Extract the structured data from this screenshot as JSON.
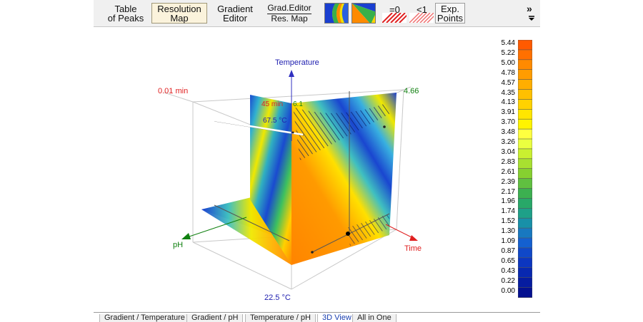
{
  "toolbar": {
    "table_of_peaks": [
      "Table",
      "of Peaks"
    ],
    "resolution_map": [
      "Resolution",
      "Map"
    ],
    "gradient_editor": [
      "Gradient",
      "Editor"
    ],
    "grad_editor_res_map": [
      "Grad.Editor",
      "Res. Map"
    ],
    "eq0_label": "=0",
    "lt1_label": "<1",
    "exp_points": [
      "Exp.",
      "Points"
    ],
    "more_label": "»"
  },
  "plot": {
    "axis_temperature": "Temperature",
    "axis_ph": "pH",
    "axis_time": "Time",
    "corner_time_start": "0.01 min",
    "corner_ph_max": "4.66",
    "corner_temp_min": "22.5 °C",
    "cursor_time": "45 min",
    "cursor_ph": "6.1",
    "cursor_temp": "67.5 °C"
  },
  "legend": {
    "values": [
      "5.44",
      "5.22",
      "5.00",
      "4.78",
      "4.57",
      "4.35",
      "4.13",
      "3.91",
      "3.70",
      "3.48",
      "3.26",
      "3.04",
      "2.83",
      "2.61",
      "2.39",
      "2.17",
      "1.96",
      "1.74",
      "1.52",
      "1.30",
      "1.09",
      "0.87",
      "0.65",
      "0.43",
      "0.22",
      "0.00"
    ],
    "colors": [
      "#ff5a00",
      "#ff7000",
      "#ff8a00",
      "#ff9c00",
      "#ffae00",
      "#ffc000",
      "#ffd200",
      "#ffe600",
      "#fff400",
      "#ffff40",
      "#eaff40",
      "#caf030",
      "#a8e030",
      "#86d030",
      "#60c040",
      "#3cb050",
      "#28a868",
      "#1ea088",
      "#1890a8",
      "#1878c0",
      "#1460d0",
      "#1048c8",
      "#0c36c0",
      "#0828b0",
      "#061ca0",
      "#041090"
    ]
  },
  "tabs": [
    {
      "label": "Gradient / Temperature"
    },
    {
      "label": "Gradient / pH"
    },
    {
      "label": "Temperature / pH"
    },
    {
      "label": "3D View"
    },
    {
      "label": "All in One"
    }
  ]
}
